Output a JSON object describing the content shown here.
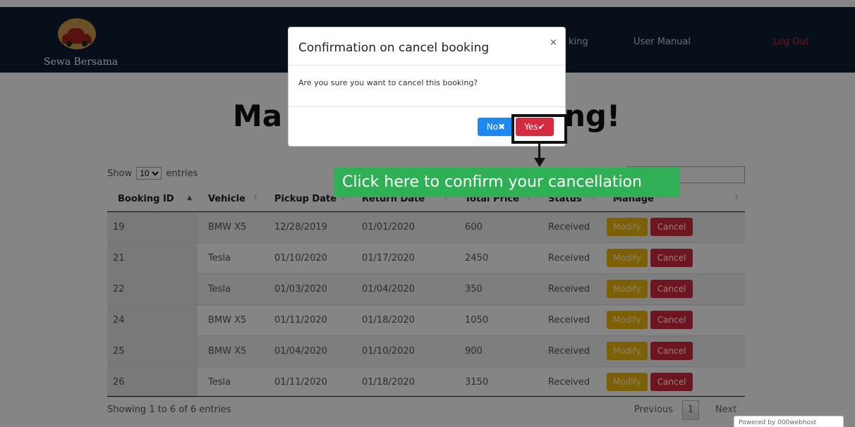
{
  "brand": {
    "name": "Sewa Bersama"
  },
  "nav": {
    "bookings": "king",
    "manual": "User Manual",
    "logout": "Log Out"
  },
  "page": {
    "title_left": "Ma",
    "title_right": "ng!"
  },
  "datatable": {
    "show_prefix": "Show",
    "show_value": "10",
    "show_suffix": "entries",
    "headers": [
      "Booking ID",
      "Vehicle",
      "Pickup Date",
      "Return Date",
      "Total Price",
      "Status",
      "Manage"
    ],
    "rows": [
      {
        "id": "19",
        "vehicle": "BMW X5",
        "pickup": "12/28/2019",
        "return": "01/01/2020",
        "price": "600",
        "status": "Received"
      },
      {
        "id": "21",
        "vehicle": "Tesla",
        "pickup": "01/10/2020",
        "return": "01/17/2020",
        "price": "2450",
        "status": "Received"
      },
      {
        "id": "22",
        "vehicle": "Tesla",
        "pickup": "01/03/2020",
        "return": "01/04/2020",
        "price": "350",
        "status": "Received"
      },
      {
        "id": "24",
        "vehicle": "BMW X5",
        "pickup": "01/11/2020",
        "return": "01/18/2020",
        "price": "1050",
        "status": "Received"
      },
      {
        "id": "25",
        "vehicle": "BMW X5",
        "pickup": "01/04/2020",
        "return": "01/10/2020",
        "price": "900",
        "status": "Received"
      },
      {
        "id": "26",
        "vehicle": "Tesla",
        "pickup": "01/11/2020",
        "return": "01/18/2020",
        "price": "3150",
        "status": "Received"
      }
    ],
    "modify_label": "Modify",
    "cancel_label": "Cancel",
    "info": "Showing 1 to 6 of 6 entries",
    "pager": {
      "previous": "Previous",
      "page": "1",
      "next": "Next"
    }
  },
  "modal": {
    "title": "Confirmation on cancel booking",
    "close": "×",
    "body": "Are you sure you want to cancel this booking?",
    "no_label": "No",
    "no_icon": "✖",
    "yes_label": "Yes",
    "yes_icon": "✔"
  },
  "annotation": {
    "callout": "Click here to confirm your cancellation"
  },
  "badge": {
    "text": "Powered by 000webhost"
  },
  "colors": {
    "navbar": "#0f1d34",
    "cancel": "#d42b3e",
    "modify": "#f0b70b",
    "no": "#1e88f0",
    "callout": "#2fb055"
  }
}
